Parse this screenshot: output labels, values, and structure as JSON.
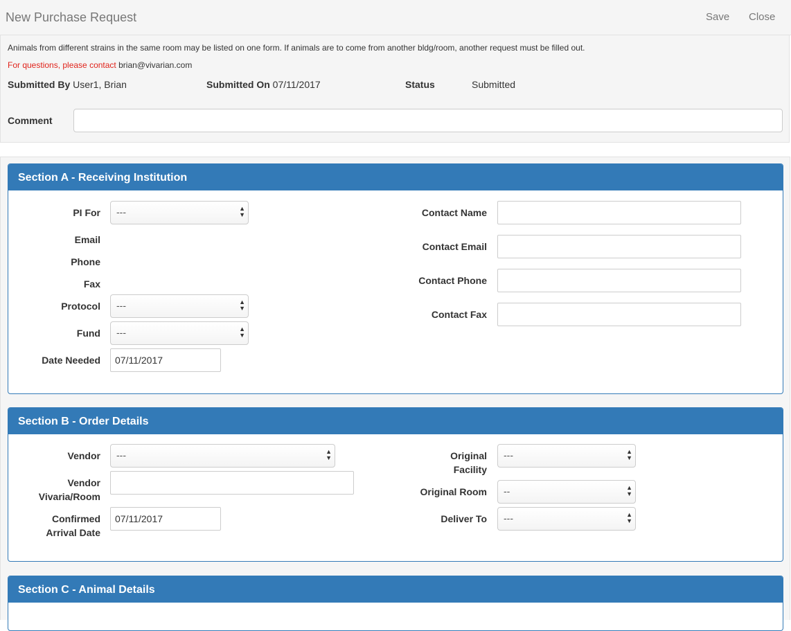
{
  "header": {
    "title": "New Purchase Request",
    "save_label": "Save",
    "close_label": "Close"
  },
  "info": {
    "note_line1": "Animals from different strains in the same room may be listed on one form. If animals are to come from another bldg/room, another request must be filled out.",
    "questions_prefix": "For questions, please contact",
    "contact_email": "brian@vivarian.com",
    "submitted_by_label": "Submitted By",
    "submitted_by_value": "User1, Brian",
    "submitted_on_label": "Submitted On",
    "submitted_on_value": "07/11/2017",
    "status_label": "Status",
    "status_value": "Submitted",
    "comment_label": "Comment",
    "comment_value": ""
  },
  "section_a": {
    "title": "Section A - Receiving Institution",
    "pi_for_label": "PI For",
    "pi_for_value": "---",
    "email_label": "Email",
    "phone_label": "Phone",
    "fax_label": "Fax",
    "protocol_label": "Protocol",
    "protocol_value": "---",
    "fund_label": "Fund",
    "fund_value": "---",
    "date_needed_label": "Date Needed",
    "date_needed_value": "07/11/2017",
    "contact_name_label": "Contact Name",
    "contact_email_label": "Contact Email",
    "contact_phone_label": "Contact Phone",
    "contact_fax_label": "Contact Fax"
  },
  "section_b": {
    "title": "Section B - Order Details",
    "vendor_label": "Vendor",
    "vendor_value": "---",
    "vendor_room_label_1": "Vendor",
    "vendor_room_label_2": "Vivaria/Room",
    "confirmed_label_1": "Confirmed",
    "confirmed_label_2": "Arrival Date",
    "confirmed_value": "07/11/2017",
    "orig_facility_label_1": "Original",
    "orig_facility_label_2": "Facility",
    "orig_facility_value": "---",
    "orig_room_label": "Original Room",
    "orig_room_value": "--",
    "deliver_to_label": "Deliver To",
    "deliver_to_value": "---"
  },
  "section_c": {
    "title": "Section C - Animal Details"
  }
}
